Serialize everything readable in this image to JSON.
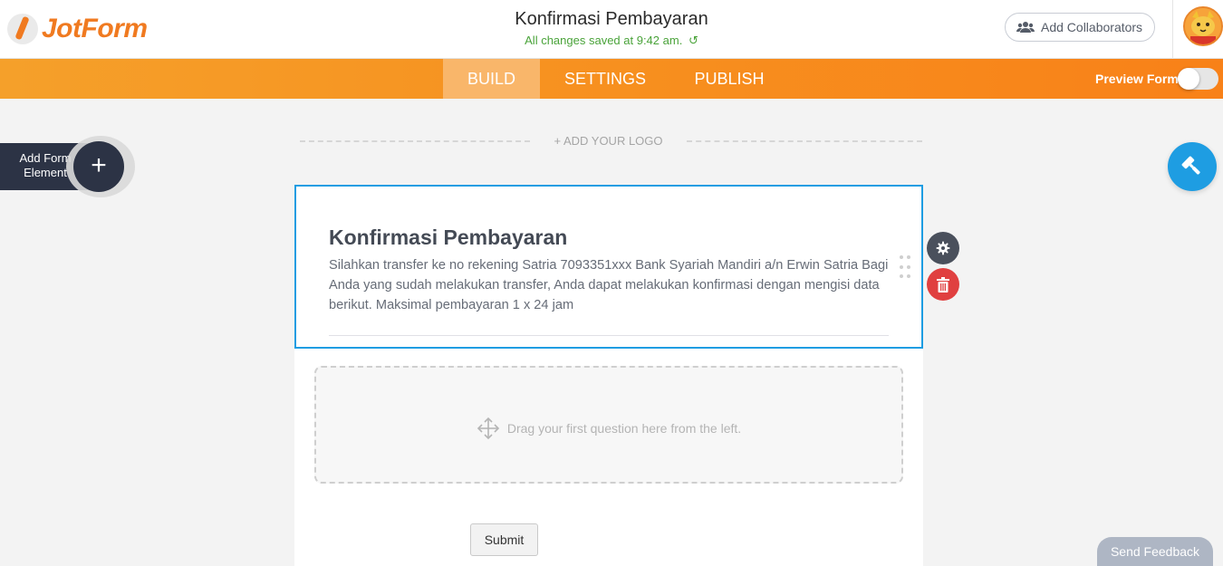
{
  "header": {
    "logo_text": "JotForm",
    "form_title": "Konfirmasi Pembayaran",
    "save_status": "All changes saved at 9:42 am.",
    "collaborators_label": "Add Collaborators"
  },
  "nav": {
    "tabs": [
      {
        "label": "BUILD",
        "active": true
      },
      {
        "label": "SETTINGS",
        "active": false
      },
      {
        "label": "PUBLISH",
        "active": false
      }
    ],
    "preview_label": "Preview Form",
    "preview_enabled": false
  },
  "sidebar": {
    "add_element_label": "Add Form Element",
    "add_icon": "+"
  },
  "builder": {
    "add_logo_label": "+ ADD YOUR LOGO",
    "heading": "Konfirmasi Pembayaran",
    "description": "Silahkan transfer ke no rekening Satria 7093351xxx Bank Syariah Mandiri a/n Erwin Satria Bagi Anda yang sudah melakukan transfer, Anda dapat melakukan konfirmasi dengan mengisi data berikut. Maksimal pembayaran 1 x 24 jam",
    "drop_zone_text": "Drag your first question here from the left.",
    "submit_label": "Submit"
  },
  "footer": {
    "feedback_label": "Send Feedback"
  },
  "colors": {
    "brand_orange": "#f7901f",
    "accent_blue": "#1e9de2",
    "danger_red": "#e04040",
    "dark_navy": "#2c3345",
    "success_green": "#4aa33a"
  },
  "icons": [
    "logo-icon",
    "refresh-icon",
    "collaborators-icon",
    "avatar-icon",
    "plus-icon",
    "gear-icon",
    "trash-icon",
    "drag-handle-icon",
    "move-icon",
    "paint-roller-icon"
  ]
}
